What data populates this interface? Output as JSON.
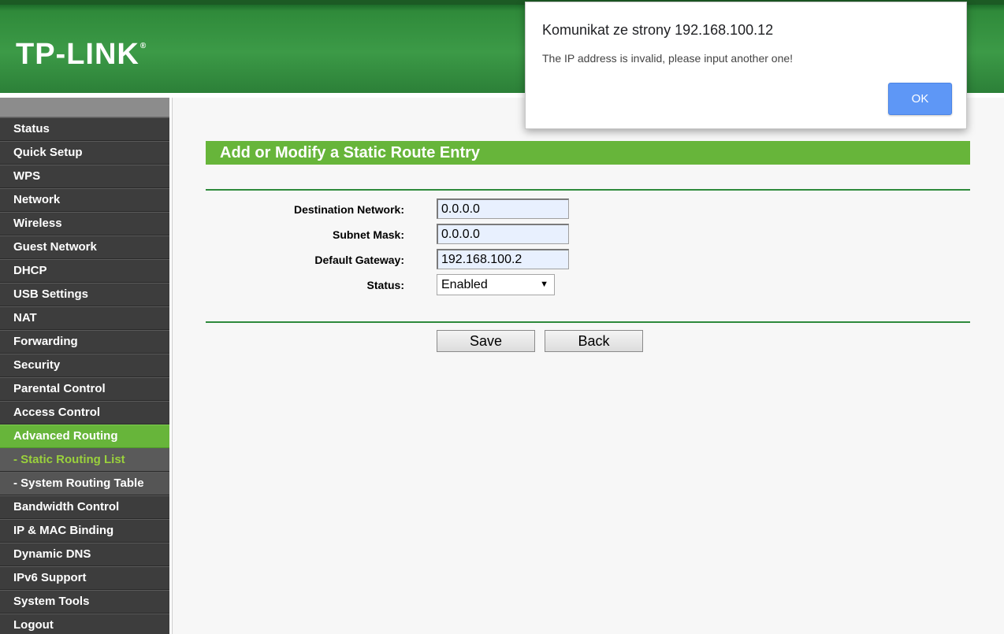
{
  "header": {
    "logo_text": "TP-LINK",
    "logo_mark": "®",
    "brand_color": "#2f8a3a"
  },
  "sidebar": {
    "items": [
      {
        "label": "Status"
      },
      {
        "label": "Quick Setup"
      },
      {
        "label": "WPS"
      },
      {
        "label": "Network"
      },
      {
        "label": "Wireless"
      },
      {
        "label": "Guest Network"
      },
      {
        "label": "DHCP"
      },
      {
        "label": "USB Settings"
      },
      {
        "label": "NAT"
      },
      {
        "label": "Forwarding"
      },
      {
        "label": "Security"
      },
      {
        "label": "Parental Control"
      },
      {
        "label": "Access Control"
      },
      {
        "label": "Advanced Routing"
      },
      {
        "label": "- Static Routing List"
      },
      {
        "label": "- System Routing Table"
      },
      {
        "label": "Bandwidth Control"
      },
      {
        "label": "IP & MAC Binding"
      },
      {
        "label": "Dynamic DNS"
      },
      {
        "label": "IPv6 Support"
      },
      {
        "label": "System Tools"
      },
      {
        "label": "Logout"
      }
    ],
    "active_color": "#67b53a",
    "current_sub_color": "#9ad13c"
  },
  "main": {
    "title": "Add or Modify a Static Route Entry",
    "form": {
      "destination_label": "Destination Network:",
      "destination_value": "0.0.0.0",
      "subnet_label": "Subnet Mask:",
      "subnet_value": "0.0.0.0",
      "gateway_label": "Default Gateway:",
      "gateway_value": "192.168.100.2",
      "status_label": "Status:",
      "status_value": "Enabled"
    },
    "save_label": "Save",
    "back_label": "Back"
  },
  "dialog": {
    "title": "Komunikat ze strony 192.168.100.12",
    "message": "The IP address is invalid, please input another one!",
    "ok_label": "OK",
    "ok_color": "#5e97f6"
  }
}
